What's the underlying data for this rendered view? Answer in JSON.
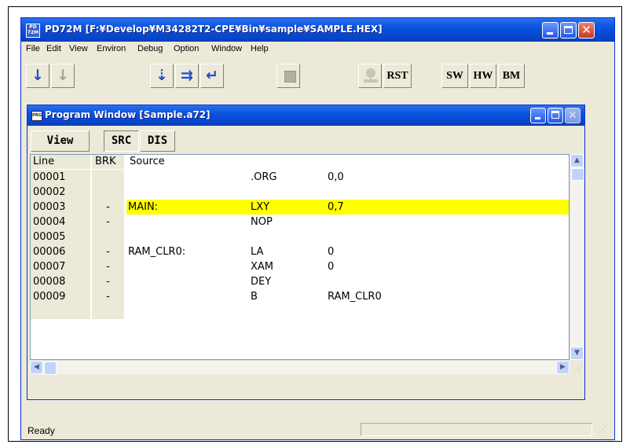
{
  "app": {
    "title": "PD72M [F:¥Develop¥M34282T2-CPE¥Bin¥sample¥SAMPLE.HEX]",
    "icon_label": "PD 72M",
    "controls": [
      "minimize-icon",
      "maximize-icon",
      "close-icon"
    ]
  },
  "menu": [
    "File",
    "Edit",
    "View",
    "Environ",
    "Debug",
    "Option",
    "Window",
    "Help"
  ],
  "toolbar": {
    "icons": {
      "go": "↓",
      "go_disabled": "↓",
      "step": "⇣",
      "over": "⇉",
      "return": "↵"
    },
    "rst": "RST",
    "sw": "SW",
    "hw": "HW",
    "bm": "BM"
  },
  "program_window": {
    "title": "Program Window [Sample.a72]",
    "icon_label": "PRG",
    "view_button": "View",
    "tabs": [
      "SRC",
      "DIS"
    ],
    "active_tab": "SRC",
    "columns": [
      "Line",
      "BRK",
      "Source"
    ],
    "rows": [
      {
        "line": "00001",
        "brk": "",
        "label": "",
        "op": ".ORG",
        "arg": "0,0",
        "highlight": false
      },
      {
        "line": "00002",
        "brk": "",
        "label": "",
        "op": "",
        "arg": "",
        "highlight": false
      },
      {
        "line": "00003",
        "brk": "-",
        "label": "MAIN:",
        "op": "LXY",
        "arg": "0,7",
        "highlight": true
      },
      {
        "line": "00004",
        "brk": "-",
        "label": "",
        "op": "NOP",
        "arg": "",
        "highlight": false
      },
      {
        "line": "00005",
        "brk": "",
        "label": "",
        "op": "",
        "arg": "",
        "highlight": false
      },
      {
        "line": "00006",
        "brk": "-",
        "label": "RAM_CLR0:",
        "op": "LA",
        "arg": "0",
        "highlight": false
      },
      {
        "line": "00007",
        "brk": "-",
        "label": "",
        "op": "XAM",
        "arg": "0",
        "highlight": false
      },
      {
        "line": "00008",
        "brk": "-",
        "label": "",
        "op": "DEY",
        "arg": "",
        "highlight": false
      },
      {
        "line": "00009",
        "brk": "-",
        "label": "",
        "op": "B",
        "arg": "RAM_CLR0",
        "highlight": false
      },
      {
        "line": "",
        "brk": "",
        "label": "",
        "op": "",
        "arg": "",
        "highlight": false
      }
    ],
    "highlight_color": "#FFFF00"
  },
  "status": {
    "text": "Ready"
  },
  "annotation_arrow": "◄"
}
